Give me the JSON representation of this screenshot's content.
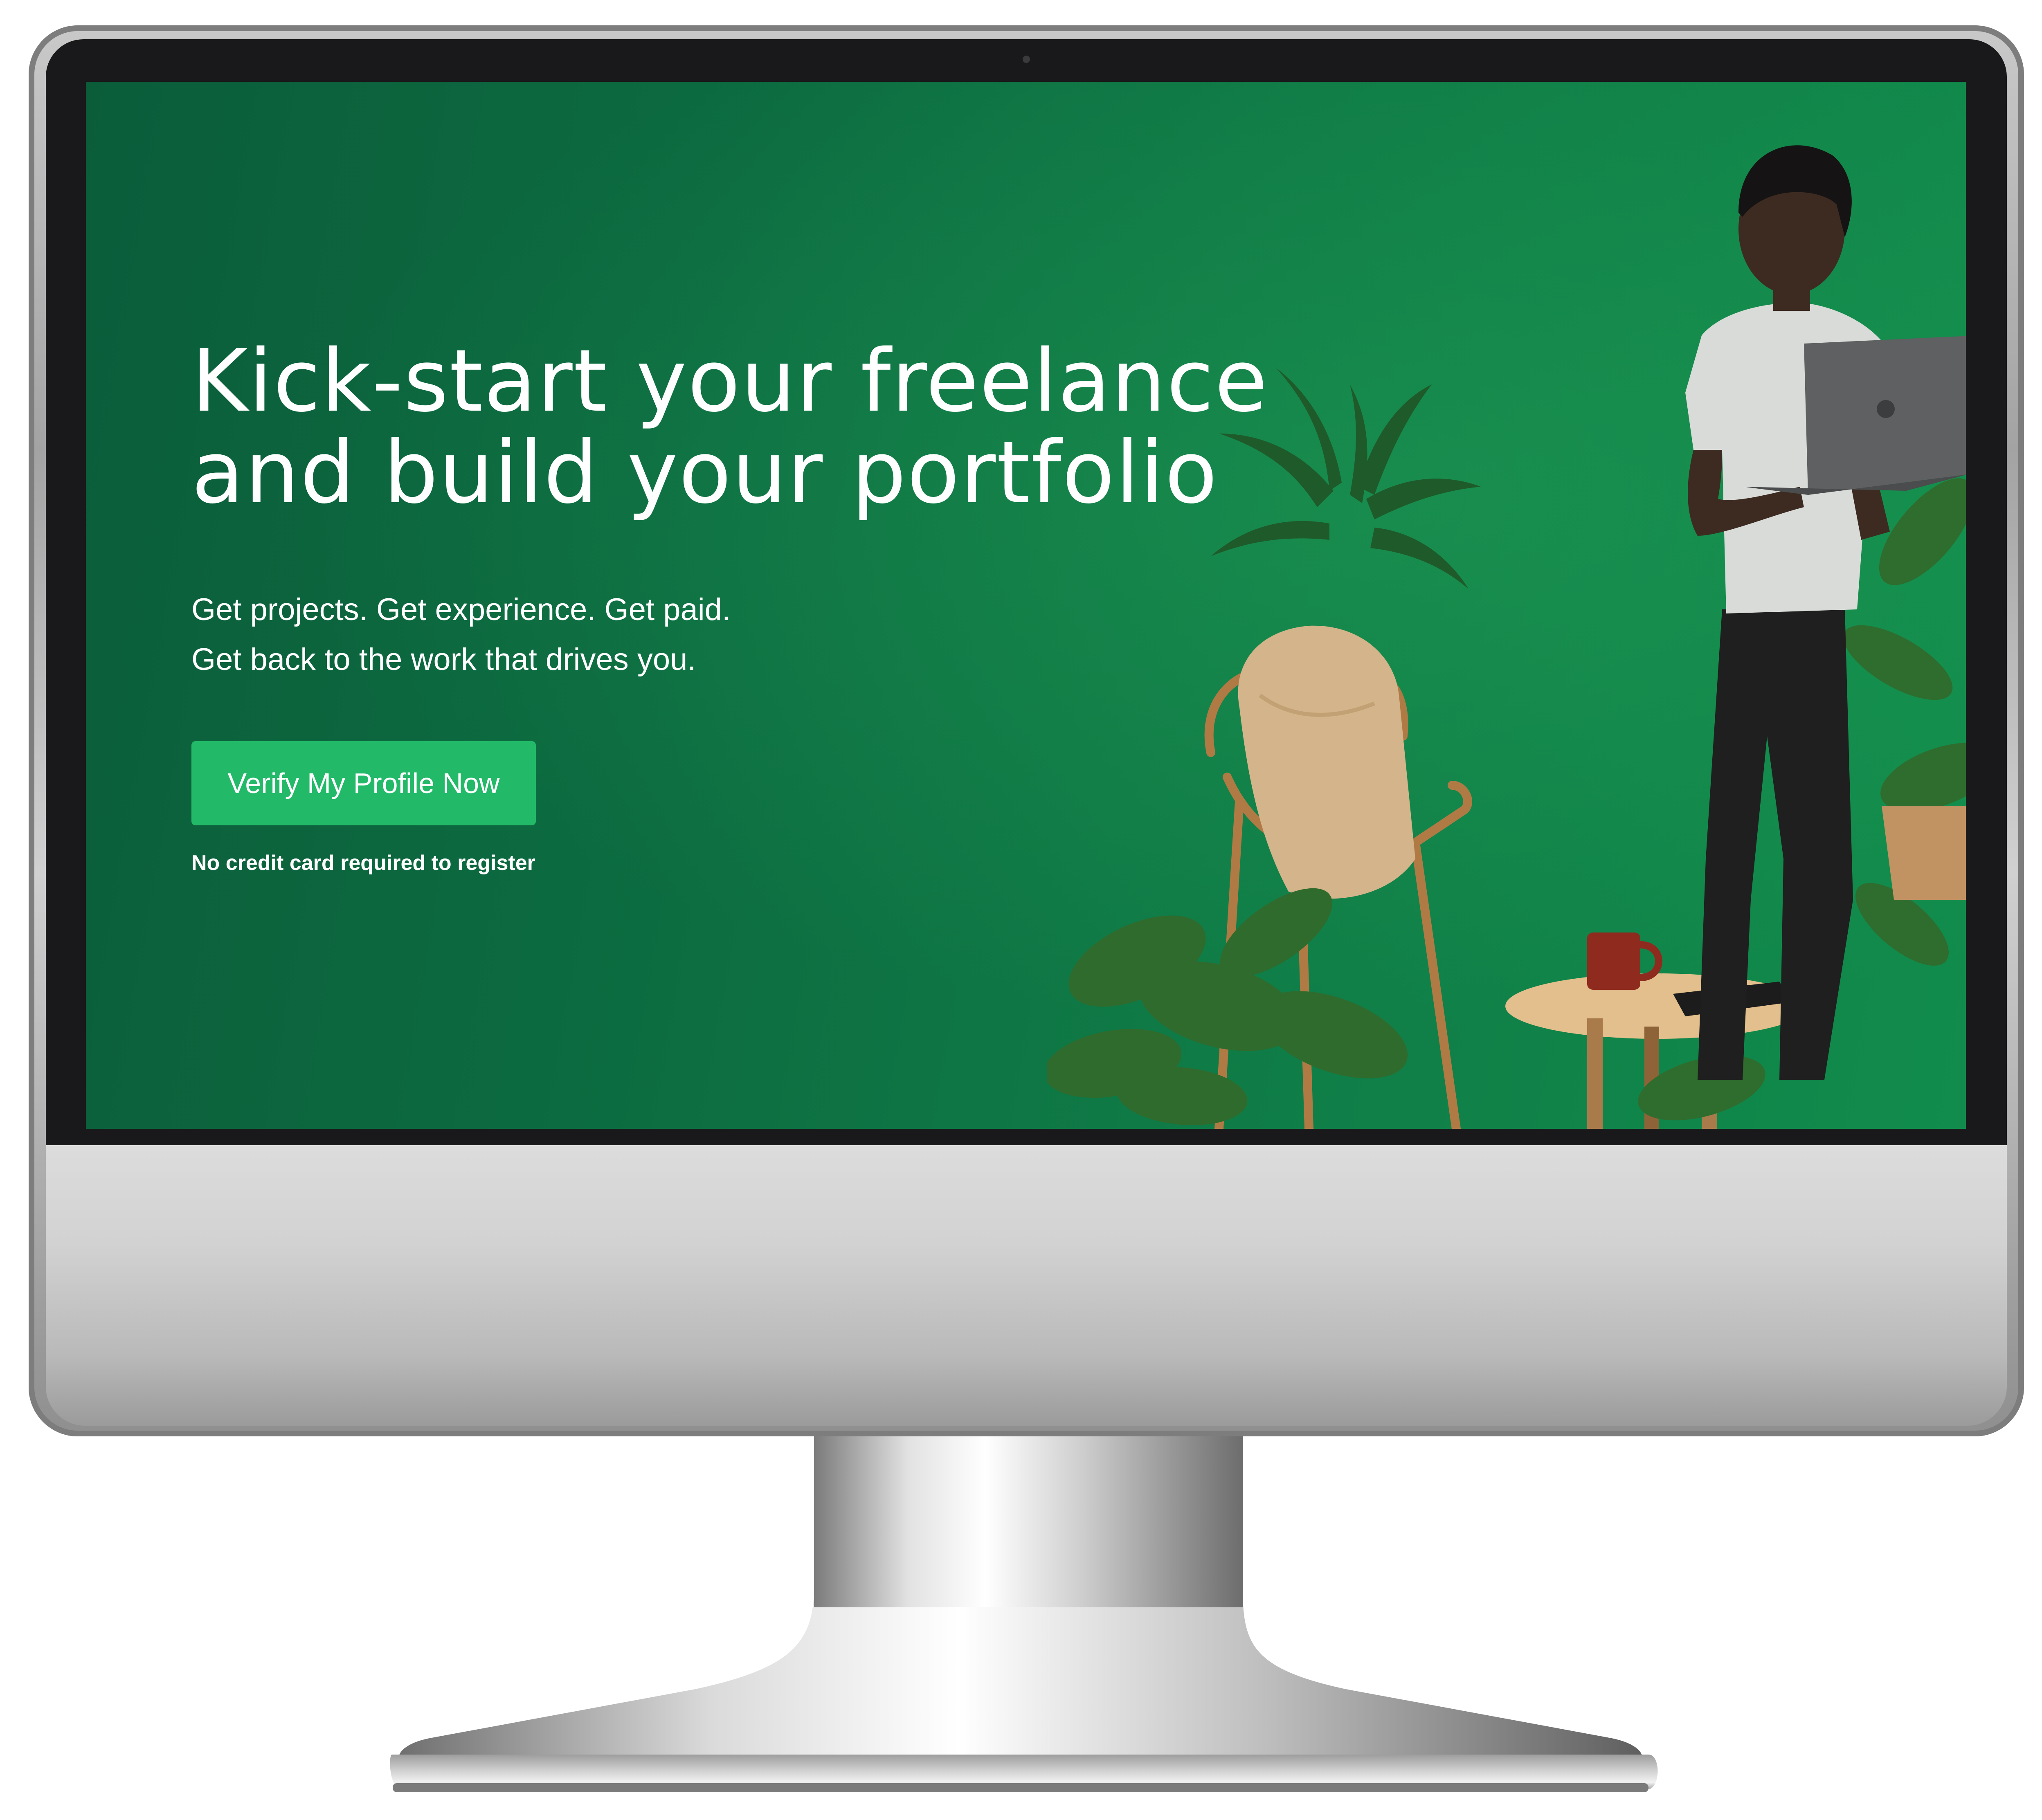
{
  "hero": {
    "title_line1": "Kick-start your freelance",
    "title_line2": "and build your portfolio",
    "subtitle_line1": "Get projects. Get experience. Get paid.",
    "subtitle_line2": "Get back to the work that drives you.",
    "cta_label": "Verify My Profile Now",
    "cta_note": "No credit card required to register"
  },
  "colors": {
    "background_green": "#0c6a40",
    "cta_green": "#22b968",
    "text": "#ffffff",
    "monitor_silver": "#c9c9c9",
    "bezel": "#19191b"
  },
  "icons": [
    "camera-icon"
  ]
}
